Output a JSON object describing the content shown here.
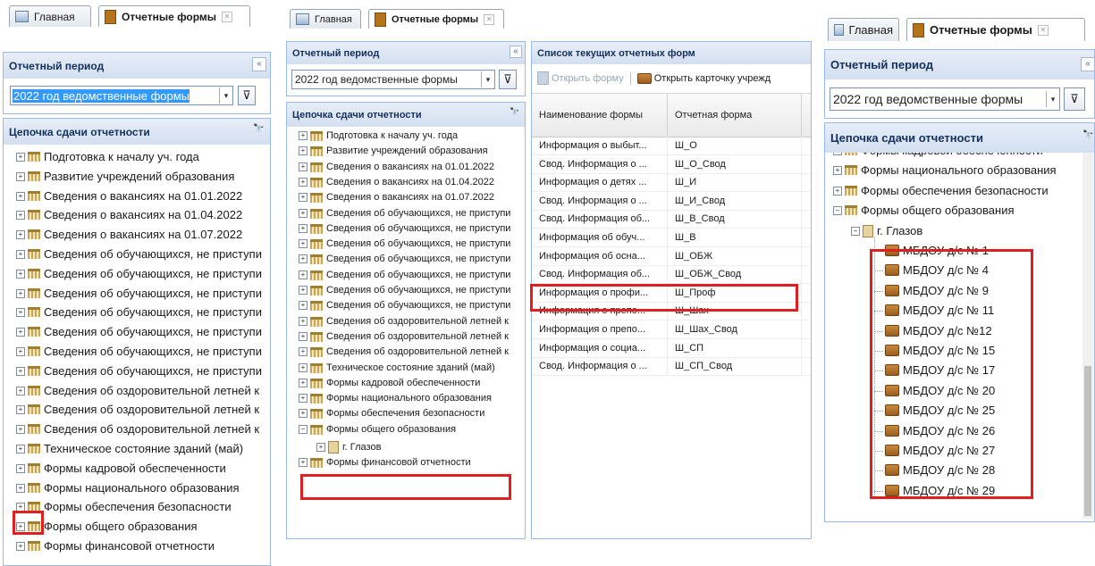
{
  "tabs": {
    "home": "Главная",
    "forms": "Отчетные формы"
  },
  "close_glyph": "✕",
  "collapse_glyph": "«",
  "filter_glyph": "⊽",
  "arrow_glyph": "▾",
  "binoculars_glyph": "🔭",
  "period": {
    "title": "Отчетный период",
    "value": "2022 год ведомственные формы"
  },
  "chain_title": "Цепочка сдачи отчетности",
  "forms_list": {
    "title": "Список текущих отчетных форм",
    "open_form": "Открыть форму",
    "open_card": "Открыть карточку учрежд",
    "columns": [
      "Наименование формы",
      "Отчетная форма"
    ],
    "rows": [
      [
        "Информация о выбыт...",
        "Ш_О"
      ],
      [
        "Свод. Информация о ...",
        "Ш_О_Свод"
      ],
      [
        "Информация о детях ...",
        "Ш_И"
      ],
      [
        "Свод. Информация о ...",
        "Ш_И_Свод"
      ],
      [
        "Свод. Информация об...",
        "Ш_В_Свод"
      ],
      [
        "Информация об обуч...",
        "Ш_В"
      ],
      [
        "Информация об осна...",
        "Ш_ОБЖ"
      ],
      [
        "Свод. Информация об...",
        "Ш_ОБЖ_Свод"
      ],
      [
        "Информация о профи...",
        "Ш_Проф"
      ],
      [
        "Информация о препо...",
        "Ш_Шах"
      ],
      [
        "Информация о препо...",
        "Ш_Шах_Свод"
      ],
      [
        "Информация о социа...",
        "Ш_СП"
      ],
      [
        "Свод. Информация о ...",
        "Ш_СП_Свод"
      ]
    ]
  },
  "tree_items": [
    "Подготовка к началу уч. года",
    "Развитие учреждений образования",
    "Сведения о вакансиях на 01.01.2022",
    "Сведения о вакансиях на 01.04.2022",
    "Сведения о вакансиях на 01.07.2022",
    "Сведения об обучающихся, не приступи",
    "Сведения об обучающихся, не приступи",
    "Сведения об обучающихся, не приступи",
    "Сведения об обучающихся, не приступи",
    "Сведения об обучающихся, не приступи",
    "Сведения об обучающихся, не приступи",
    "Сведения об обучающихся, не приступи",
    "Сведения об оздоровительной летней к",
    "Сведения об оздоровительной летней к",
    "Сведения об оздоровительной летней к",
    "Техническое состояние зданий (май)",
    "Формы кадровой обеспеченности",
    "Формы национального образования",
    "Формы обеспечения безопасности",
    "Формы общего образования",
    "Формы финансовой отчетности"
  ],
  "city": "г. Глазов",
  "right_tree_top": [
    "Формы кадровой обеспеченности",
    "Формы национального образования",
    "Формы обеспечения безопасности",
    "Формы общего образования"
  ],
  "schools": [
    "МБДОУ д/с № 1",
    "МБДОУ д/с № 4",
    "МБДОУ д/с № 9",
    "МБДОУ д/с № 11",
    "МБДОУ д/с №12",
    "МБДОУ д/с № 15",
    "МБДОУ д/с № 17",
    "МБДОУ д/с № 20",
    "МБДОУ д/с № 25",
    "МБДОУ д/с № 26",
    "МБДОУ д/с № 27",
    "МБДОУ д/с № 28",
    "МБДОУ д/с № 29"
  ],
  "expand_plus": "+",
  "expand_minus": "−"
}
